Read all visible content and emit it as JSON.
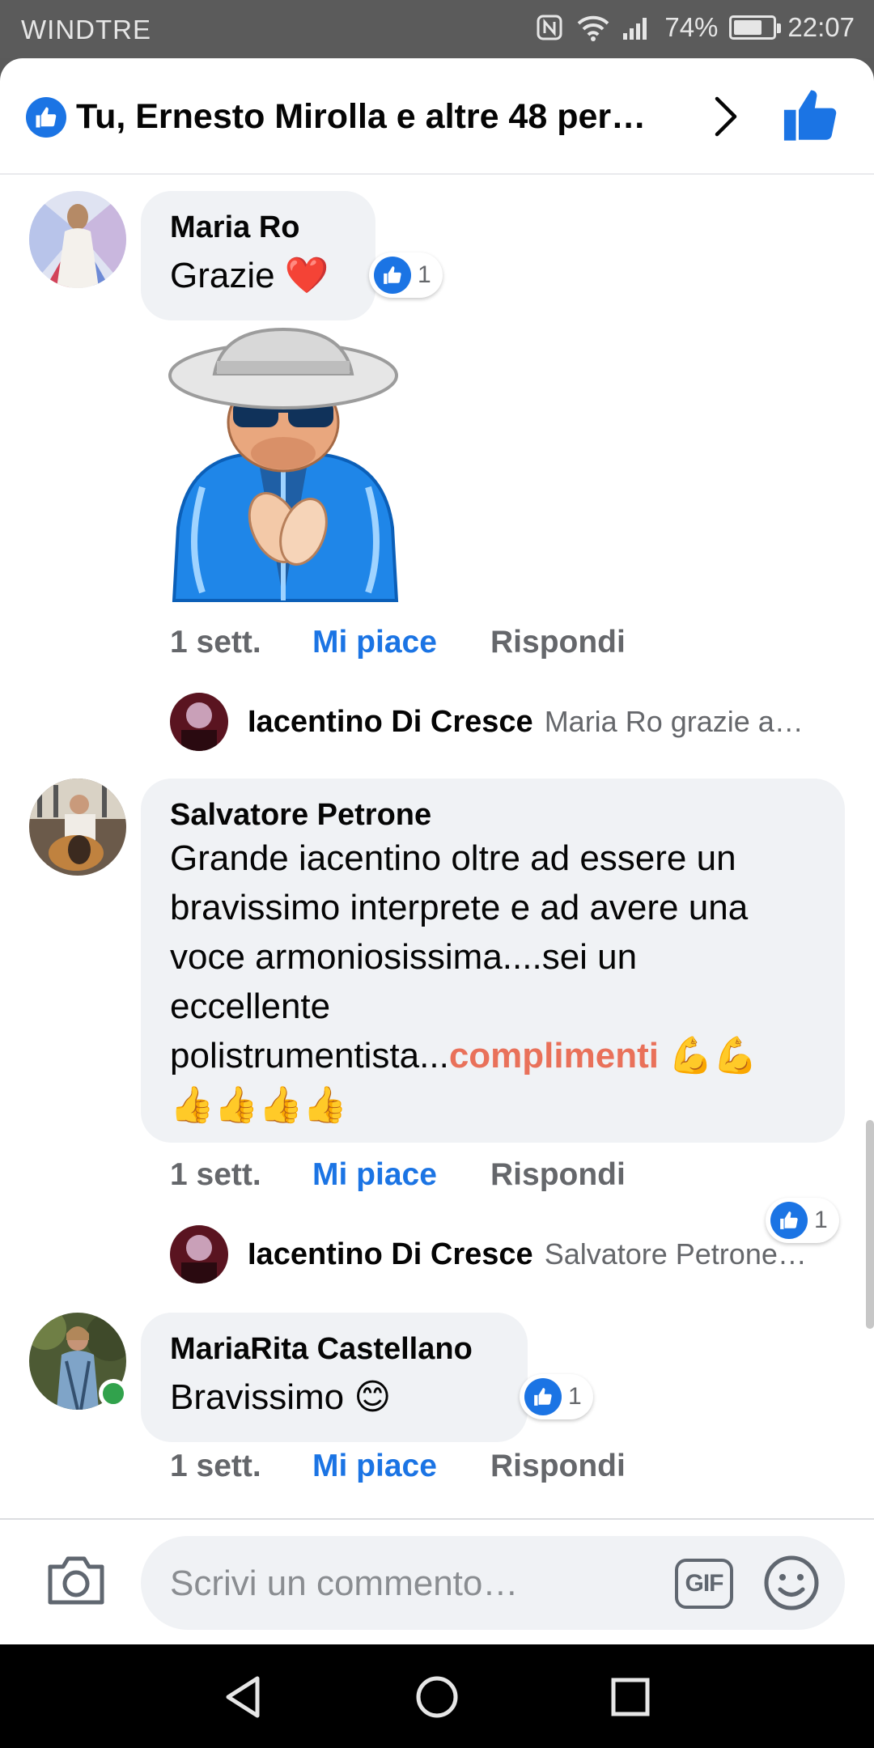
{
  "status_bar": {
    "carrier": "WINDTRE",
    "battery": "74%",
    "battery_level": 0.74,
    "time": "22:07"
  },
  "header": {
    "reactions_text": "Tu, Ernesto Mirolla e altre 48 per…"
  },
  "comments": [
    {
      "author": "Maria Ro",
      "text": "Grazie ❤️",
      "reaction_count": "1",
      "time": "1 sett.",
      "like_label": "Mi piace",
      "reply_label": "Rispondi",
      "reply": {
        "author": "Iacentino Di Cresce",
        "text": "Maria Ro grazie a…"
      }
    },
    {
      "author": "Salvatore Petrone",
      "text_lines": [
        "Grande iacentino oltre ad essere un",
        "bravissimo interprete e ad avere una",
        "voce armoniosissima....sei un",
        "eccellente",
        "polistrumentista..."
      ],
      "highlight": "complimenti",
      "emoji_line_1": "💪💪",
      "emoji_line_2": "👍👍👍👍",
      "reaction_count": "1",
      "time": "1 sett.",
      "like_label": "Mi piace",
      "reply_label": "Rispondi",
      "reply": {
        "author": "Iacentino Di Cresce",
        "text": "Salvatore Petrone…"
      }
    },
    {
      "author": "MariaRita Castellano",
      "text": "Bravissimo 😊",
      "reaction_count": "1",
      "time": "1 sett.",
      "like_label": "Mi piace",
      "reply_label": "Rispondi"
    }
  ],
  "composer": {
    "placeholder": "Scrivi un commento…",
    "gif_label": "GIF"
  },
  "colors": {
    "brand_blue": "#1b74e4",
    "bubble_bg": "#f0f2f5",
    "highlight": "#e9715a",
    "online": "#31a24c"
  },
  "icons": [
    "wifi-icon",
    "signal-icon",
    "nfc-icon",
    "like-thumb-icon",
    "chevron-right-icon",
    "camera-icon",
    "emoji-icon",
    "back-icon",
    "home-icon",
    "recents-icon"
  ]
}
